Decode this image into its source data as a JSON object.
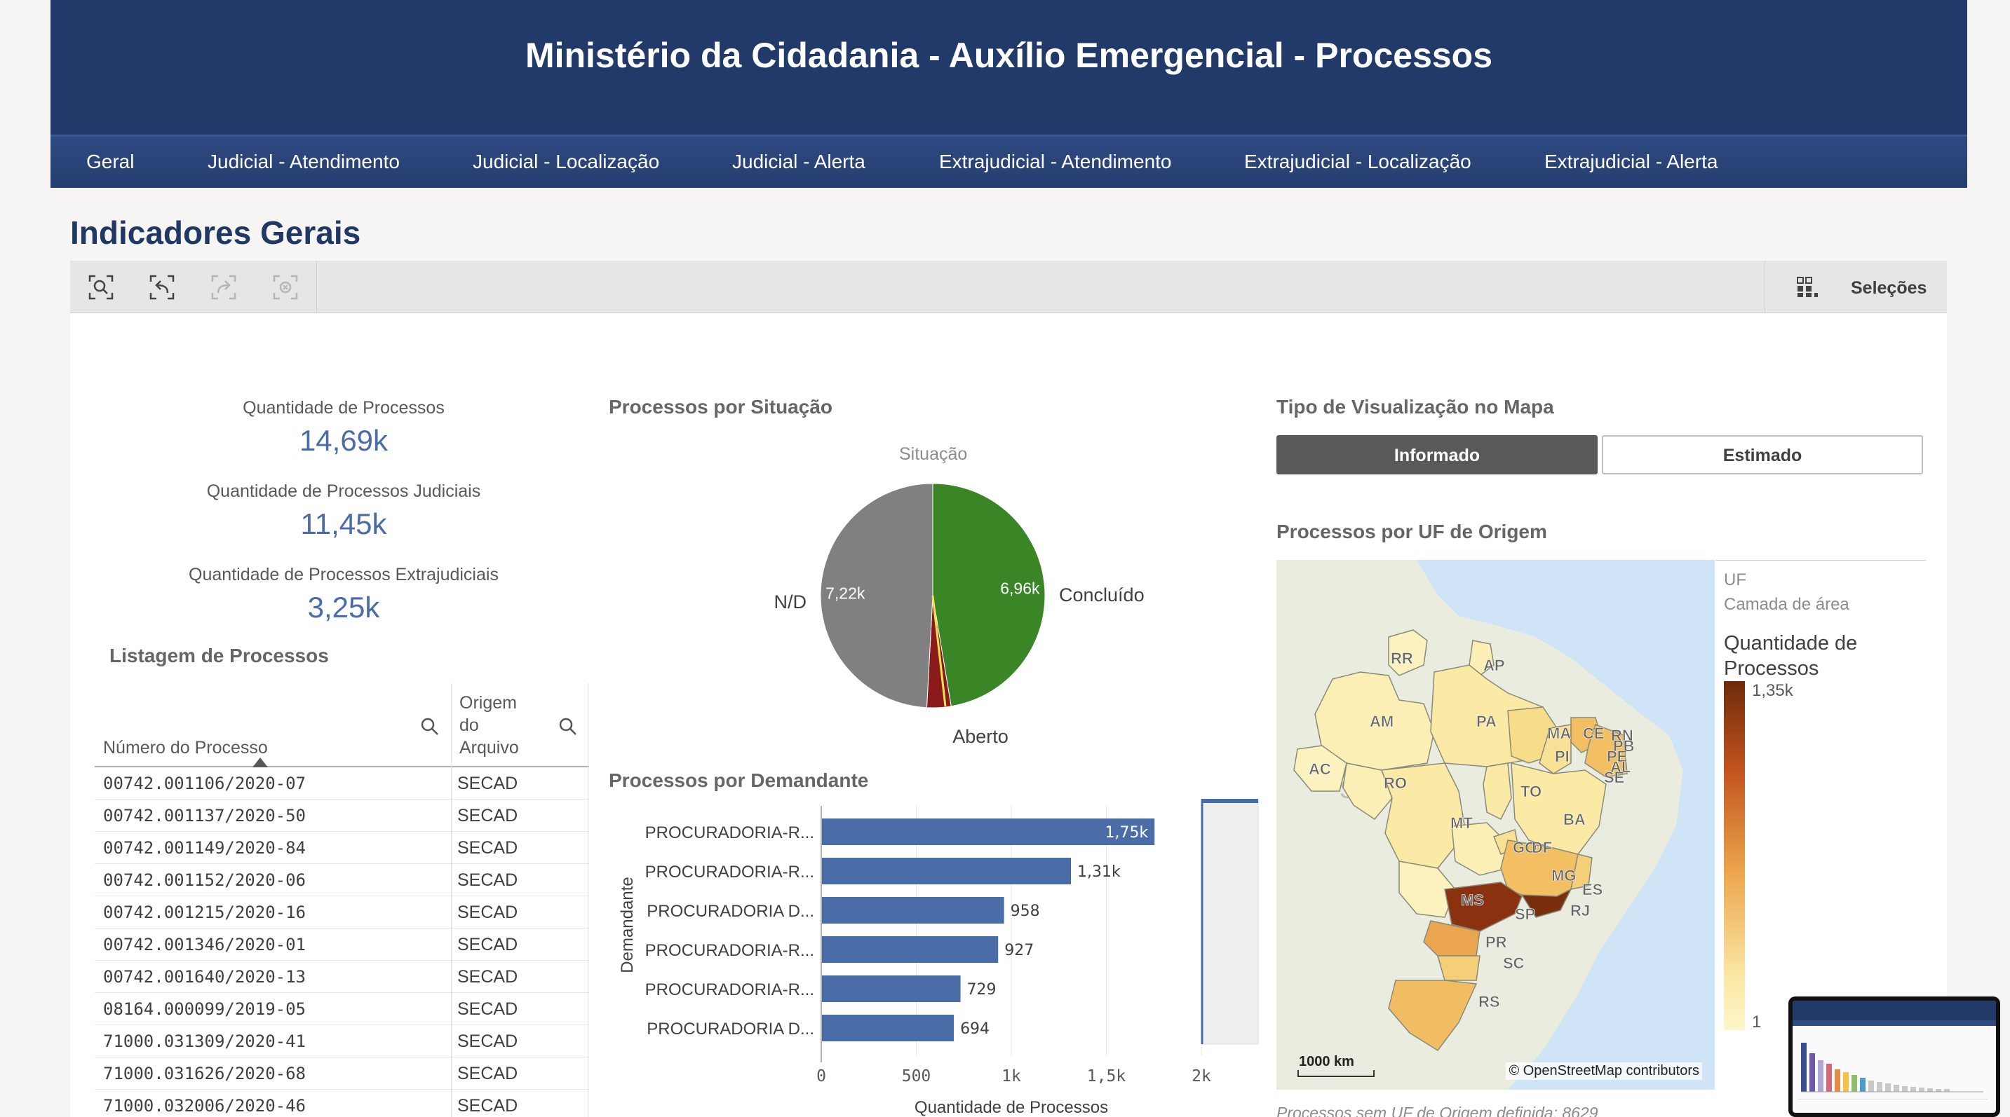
{
  "header": {
    "title": "Ministério da Cidadania - Auxílio Emergencial - Processos",
    "nav": [
      "Geral",
      "Judicial - Atendimento",
      "Judicial - Localização",
      "Judicial - Alerta",
      "Extrajudicial - Atendimento",
      "Extrajudicial - Localização",
      "Extrajudicial - Alerta"
    ]
  },
  "page_title": "Indicadores Gerais",
  "toolbar": {
    "icons": [
      "smart-search-icon",
      "step-back-icon",
      "step-forward-icon",
      "clear-selections-icon"
    ],
    "selections_label": "Seleções"
  },
  "kpis": [
    {
      "label": "Quantidade de Processos",
      "value": "14,69k"
    },
    {
      "label": "Quantidade de Processos Judiciais",
      "value": "11,45k"
    },
    {
      "label": "Quantidade de Processos Extrajudiciais",
      "value": "3,25k"
    }
  ],
  "listing": {
    "title": "Listagem de Processos",
    "columns": [
      "Número do Processo",
      "Origem do Arquivo"
    ],
    "rows": [
      [
        "00742.001106/2020-07",
        "SECAD"
      ],
      [
        "00742.001137/2020-50",
        "SECAD"
      ],
      [
        "00742.001149/2020-84",
        "SECAD"
      ],
      [
        "00742.001152/2020-06",
        "SECAD"
      ],
      [
        "00742.001215/2020-16",
        "SECAD"
      ],
      [
        "00742.001346/2020-01",
        "SECAD"
      ],
      [
        "00742.001640/2020-13",
        "SECAD"
      ],
      [
        "08164.000099/2019-05",
        "SECAD"
      ],
      [
        "71000.031309/2020-41",
        "SECAD"
      ],
      [
        "71000.031626/2020-68",
        "SECAD"
      ],
      [
        "71000.032006/2020-46",
        "SECAD"
      ]
    ]
  },
  "pie": {
    "title": "Processos por Situação",
    "legend_title": "Situação"
  },
  "bar": {
    "title": "Processos por Demandante"
  },
  "map_toggle": {
    "title": "Tipo de Visualização no Mapa",
    "options": [
      "Informado",
      "Estimado"
    ],
    "selected": "Informado"
  },
  "map": {
    "title": "Processos por UF de Origem",
    "legend_field": "UF",
    "legend_layer": "Camada de área",
    "legend_measure": "Quantidade de Processos",
    "legend_max": "1,35k",
    "legend_min": "1",
    "scale": "1000 km",
    "attribution": "© OpenStreetMap contributors",
    "note": "Processos sem UF de Origem definida: 8629",
    "labels": [
      "RR",
      "AP",
      "AM",
      "PA",
      "MA",
      "CE",
      "RN",
      "PB",
      "PE",
      "AL",
      "SE",
      "PI",
      "AC",
      "RO",
      "TO",
      "BA",
      "MT",
      "GO",
      "DF",
      "MG",
      "ES",
      "MS",
      "SP",
      "RJ",
      "PR",
      "SC",
      "RS"
    ],
    "colors": {
      "low": "#fbefb5",
      "mid": "#f2c062",
      "high": "#c0531d",
      "max": "#7a2e0e",
      "sea": "#cfe4f6"
    }
  },
  "chart_data": [
    {
      "type": "pie",
      "title": "Processos por Situação",
      "legend_title": "Situação",
      "slices": [
        {
          "name": "Concluído",
          "value": 6960,
          "label": "6,96k",
          "color": "#3a8526"
        },
        {
          "name": "Aberto",
          "value": 510,
          "label": "",
          "color": "#8b1a1a"
        },
        {
          "name": "N/D",
          "value": 7220,
          "label": "7,22k",
          "color": "#808080"
        }
      ]
    },
    {
      "type": "bar",
      "orientation": "horizontal",
      "title": "Processos por Demandante",
      "xlabel": "Quantidade de Processos",
      "ylabel": "Demandante",
      "xlim": [
        0,
        2000
      ],
      "xticks": [
        "0",
        "500",
        "1k",
        "1,5k",
        "2k"
      ],
      "categories": [
        "PROCURADORIA-R...",
        "PROCURADORIA-R...",
        "PROCURADORIA D...",
        "PROCURADORIA-R...",
        "PROCURADORIA-R...",
        "PROCURADORIA D..."
      ],
      "values": [
        1750,
        1310,
        958,
        927,
        729,
        694
      ],
      "value_labels": [
        "1,75k",
        "1,31k",
        "958",
        "927",
        "729",
        "694"
      ],
      "color": "#4a6da7"
    }
  ]
}
